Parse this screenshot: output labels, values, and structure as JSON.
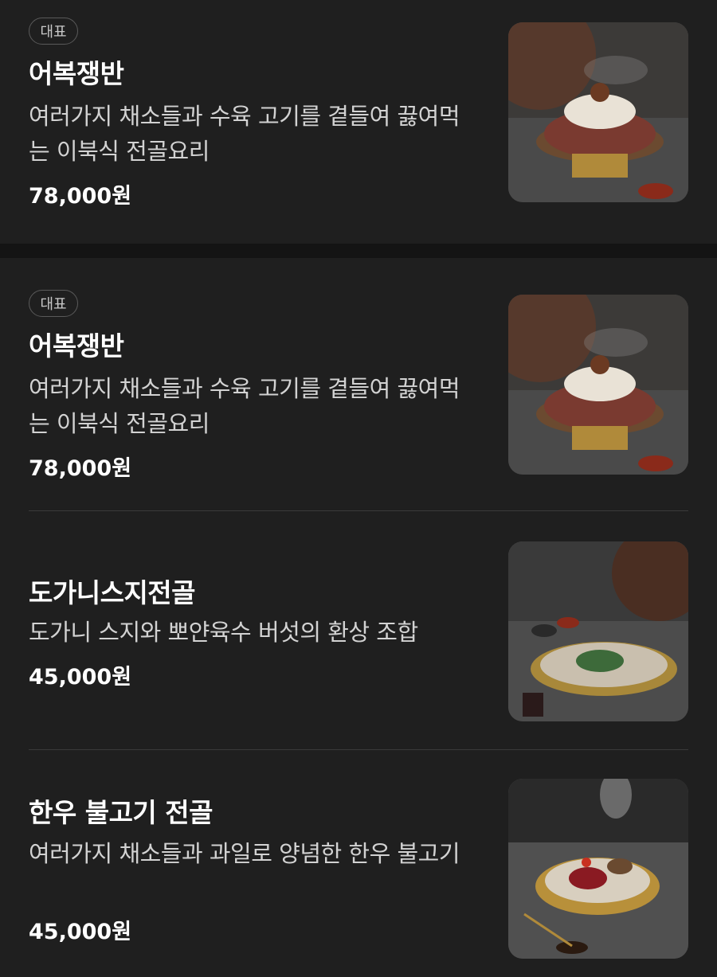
{
  "menu": {
    "items": [
      {
        "badge": "대표",
        "name": "어복쟁반",
        "description": "여러가지 채소들과 수육 고기를 곁들여 끓여먹는 이북식 전골요리",
        "price": "78,000원",
        "image": "eobok-jaengban-photo"
      },
      {
        "badge": "대표",
        "name": "어복쟁반",
        "description": "여러가지 채소들과 수육 고기를 곁들여 끓여먹는 이북식 전골요리",
        "price": "78,000원",
        "image": "eobok-jaengban-photo"
      },
      {
        "name": "도가니스지전골",
        "description": "도가니 스지와 뽀얀육수 버섯의 환상 조합",
        "price": "45,000원",
        "image": "dogani-suji-jeongol-photo"
      },
      {
        "name": "한우 불고기 전골",
        "description": "여러가지 채소들과 과일로 양념한 한우 불고기",
        "price": "45,000원",
        "image": "hanwoo-bulgogi-jeongol-photo"
      }
    ]
  },
  "colors": {
    "background": "#1f1f1f",
    "section_gap": "#141414",
    "divider": "#3a3a3a",
    "badge_border": "#5a5a5a",
    "text_primary": "#ffffff",
    "text_secondary": "#d2d2d2"
  }
}
